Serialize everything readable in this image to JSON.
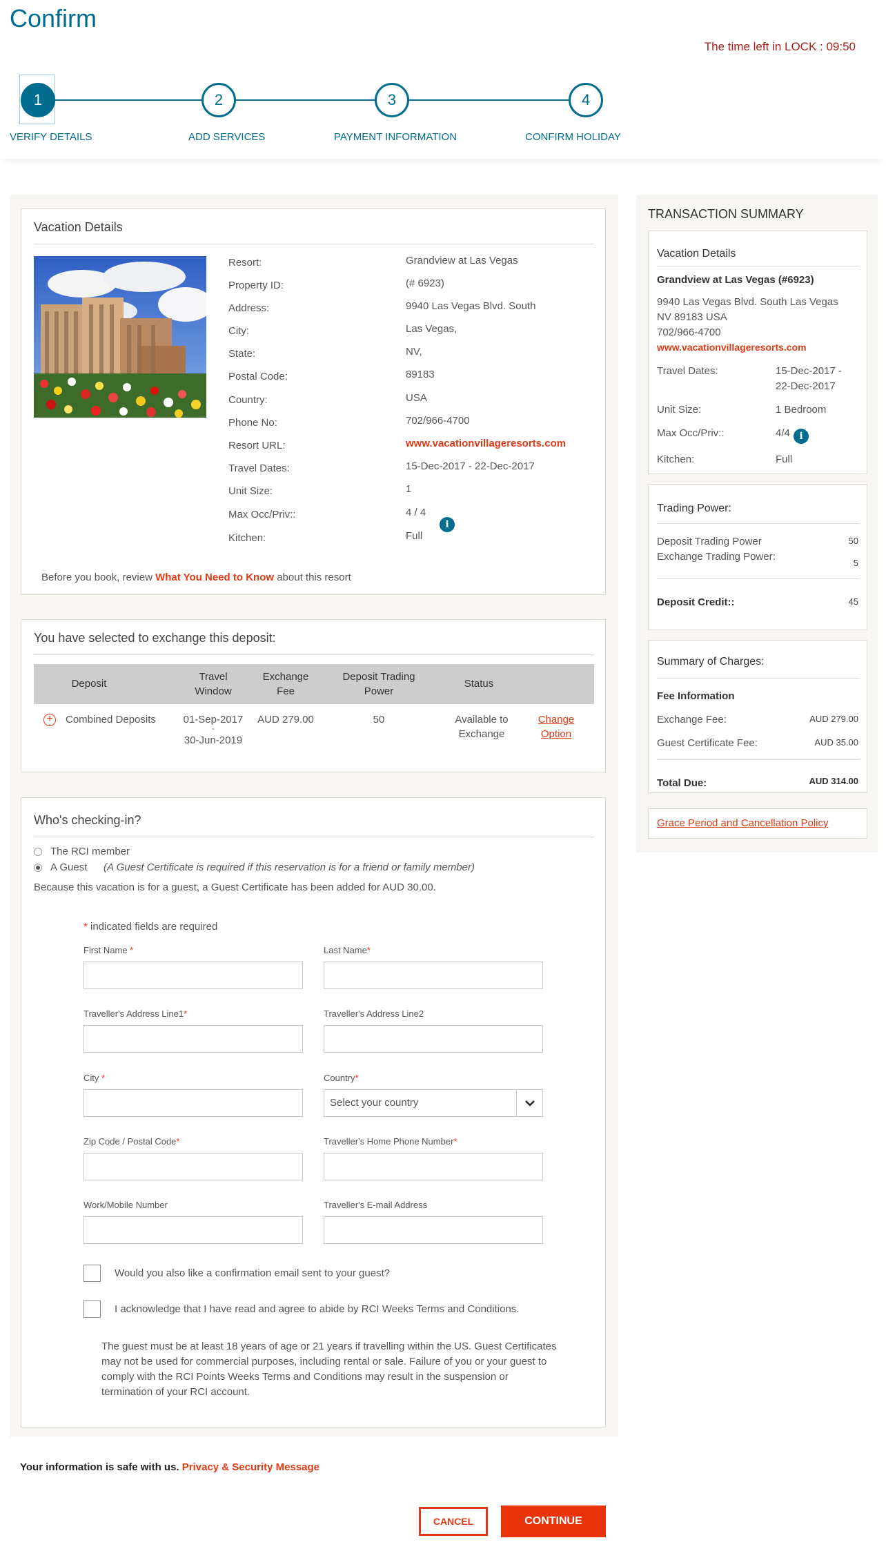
{
  "page": {
    "title": "Confirm",
    "timer": "The time left in LOCK : 09:50"
  },
  "steps": [
    {
      "number": "1",
      "label": "VERIFY DETAILS"
    },
    {
      "number": "2",
      "label": "ADD SERVICES"
    },
    {
      "number": "3",
      "label": "PAYMENT INFORMATION"
    },
    {
      "number": "4",
      "label": "CONFIRM HOLIDAY"
    }
  ],
  "vacation": {
    "heading": "Vacation Details",
    "rows": [
      {
        "label": "Resort:",
        "value": "Grandview at Las Vegas"
      },
      {
        "label": "Property ID:",
        "value": "(# 6923)"
      },
      {
        "label": "Address:",
        "value": "9940 Las Vegas Blvd. South"
      },
      {
        "label": "City:",
        "value": "Las Vegas,"
      },
      {
        "label": "State:",
        "value": "NV,"
      },
      {
        "label": "Postal Code:",
        "value": "89183"
      },
      {
        "label": "Country:",
        "value": "USA"
      },
      {
        "label": "Phone No:",
        "value": "702/966-4700"
      },
      {
        "label": "Resort URL:",
        "value": "www.vacationvillageresorts.com"
      },
      {
        "label": "Travel Dates:",
        "value": "15-Dec-2017 - 22-Dec-2017"
      },
      {
        "label": "Unit Size:",
        "value": "1"
      },
      {
        "label": "Max Occ/Priv::",
        "value": "4 / 4"
      },
      {
        "label": "Kitchen:",
        "value": "Full"
      }
    ],
    "info_icon": "i",
    "note_pre": "Before you book, review ",
    "note_link": "What You Need to Know",
    "note_post": " about this resort"
  },
  "deposit": {
    "heading": "You have selected to exchange this deposit:",
    "columns": [
      "Deposit",
      "Travel\nWindow",
      "Exchange\nFee",
      "Deposit Trading\nPower",
      "Status"
    ],
    "row": {
      "deposit": "Combined Deposits",
      "window_start": "01-Sep-2017",
      "window_sep": "-",
      "window_end": "30-Jun-2019",
      "fee": "AUD 279.00",
      "power": "50",
      "status": "Available to\nExchange",
      "change_1": "Change",
      "change_2": "Option"
    }
  },
  "checkin": {
    "heading": "Who's checking-in?",
    "option_member": "The RCI member",
    "option_guest": "A Guest",
    "guest_note": "(A Guest Certificate is required if this reservation is for a friend or family member)",
    "guest_added": "Because this vacation is for a guest, a Guest Certificate has been added for AUD 30.00.",
    "required_note": " indicated fields are required",
    "fields": {
      "first_name": "First Name ",
      "last_name": "Last Name",
      "address1": "Traveller's Address Line1",
      "address2": "Traveller's Address Line2",
      "city": "City ",
      "country": "Country",
      "country_placeholder": "Select your country",
      "zip": "Zip Code / Postal Code",
      "home_phone": "Traveller's Home Phone Number",
      "mobile": "Work/Mobile Number",
      "email": "Traveller's E-mail Address"
    },
    "checkbox_email": "Would you also like a confirmation email sent to your guest?",
    "checkbox_terms": "I acknowledge that I have read and agree to abide by RCI Weeks Terms and Conditions.",
    "disclaimer": "The guest must be at least 18 years of age or 21 years if travelling within the US.  Guest Certificates may not be used for commercial purposes, including rental or sale. Failure of you or your guest to comply with the RCI Points  Weeks Terms and Conditions may result in the suspension or termination of your RCI account."
  },
  "footer": {
    "safe_text": "Your information is safe with us. ",
    "privacy_link": "Privacy & Security Message",
    "cancel": "CANCEL",
    "continue": "CONTINUE"
  },
  "summary": {
    "heading": "TRANSACTION SUMMARY",
    "vacation_heading": "Vacation Details",
    "resort": "Grandview at Las Vegas (#6923)",
    "address_1": "9940 Las Vegas Blvd. South Las Vegas",
    "address_2": "NV 89183 USA",
    "phone": "702/966-4700",
    "url": "www.vacationvillageresorts.com",
    "travel_dates_label": "Travel Dates:",
    "travel_dates_1": "15-Dec-2017 -",
    "travel_dates_2": "22-Dec-2017",
    "unit_label": "Unit Size:",
    "unit_value": "1  Bedroom",
    "maxocc_label": "Max Occ/Priv::",
    "maxocc_value": "4/4",
    "kitchen_label": "Kitchen:",
    "kitchen_value": "Full",
    "trading_heading": "Trading Power:",
    "deposit_tp_label": "Deposit Trading Power",
    "deposit_tp_value": "50",
    "exchange_tp_label": "Exchange Trading Power:",
    "exchange_tp_value": "5",
    "deposit_credit_label": "Deposit Credit::",
    "deposit_credit_value": "45",
    "charges_heading": "Summary of Charges:",
    "fee_info": "Fee Information",
    "exchange_fee_label": "Exchange Fee:",
    "exchange_fee_value": "AUD 279.00",
    "guest_fee_label": "Guest Certificate Fee:",
    "guest_fee_value": "AUD 35.00",
    "total_label": "Total Due:",
    "total_value": "AUD 314.00",
    "grace_link": "Grace Period and Cancellation Policy"
  },
  "colors": {
    "brand_teal": "#006c8e",
    "accent_red": "#e03a14",
    "timer_red": "#a8201a"
  }
}
